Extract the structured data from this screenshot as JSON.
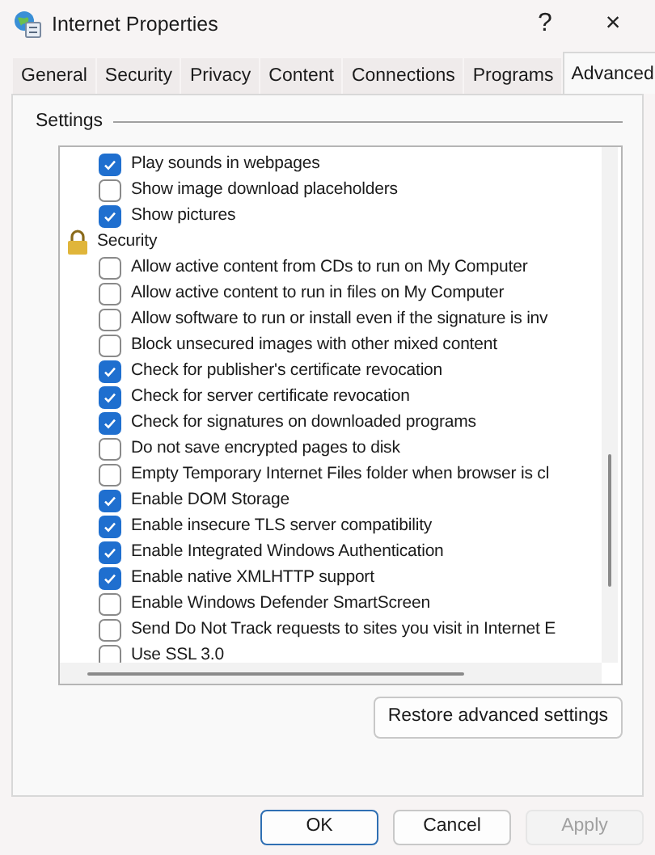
{
  "window": {
    "title": "Internet Properties",
    "help": "?",
    "close": "×"
  },
  "tabs": [
    {
      "label": "General",
      "selected": false
    },
    {
      "label": "Security",
      "selected": false
    },
    {
      "label": "Privacy",
      "selected": false
    },
    {
      "label": "Content",
      "selected": false
    },
    {
      "label": "Connections",
      "selected": false
    },
    {
      "label": "Programs",
      "selected": false
    },
    {
      "label": "Advanced",
      "selected": true
    }
  ],
  "settings_label": "Settings",
  "settings": [
    {
      "kind": "checkbox",
      "label": "Play sounds in webpages",
      "checked": true
    },
    {
      "kind": "checkbox",
      "label": "Show image download placeholders",
      "checked": false
    },
    {
      "kind": "checkbox",
      "label": "Show pictures",
      "checked": true
    },
    {
      "kind": "group",
      "label": "Security"
    },
    {
      "kind": "checkbox",
      "label": "Allow active content from CDs to run on My Computer",
      "checked": false
    },
    {
      "kind": "checkbox",
      "label": "Allow active content to run in files on My Computer",
      "checked": false
    },
    {
      "kind": "checkbox",
      "label": "Allow software to run or install even if the signature is inv",
      "checked": false
    },
    {
      "kind": "checkbox",
      "label": "Block unsecured images with other mixed content",
      "checked": false
    },
    {
      "kind": "checkbox",
      "label": "Check for publisher's certificate revocation",
      "checked": true
    },
    {
      "kind": "checkbox",
      "label": "Check for server certificate revocation",
      "checked": true
    },
    {
      "kind": "checkbox",
      "label": "Check for signatures on downloaded programs",
      "checked": true
    },
    {
      "kind": "checkbox",
      "label": "Do not save encrypted pages to disk",
      "checked": false
    },
    {
      "kind": "checkbox",
      "label": "Empty Temporary Internet Files folder when browser is cl",
      "checked": false
    },
    {
      "kind": "checkbox",
      "label": "Enable DOM Storage",
      "checked": true
    },
    {
      "kind": "checkbox",
      "label": "Enable insecure TLS server compatibility",
      "checked": true
    },
    {
      "kind": "checkbox",
      "label": "Enable Integrated Windows Authentication",
      "checked": true
    },
    {
      "kind": "checkbox",
      "label": "Enable native XMLHTTP support",
      "checked": true
    },
    {
      "kind": "checkbox",
      "label": "Enable Windows Defender SmartScreen",
      "checked": false
    },
    {
      "kind": "checkbox",
      "label": "Send Do Not Track requests to sites you visit in Internet E",
      "checked": false
    },
    {
      "kind": "checkbox",
      "label": "Use SSL 3.0",
      "checked": false
    }
  ],
  "restore_button": "Restore advanced settings",
  "buttons": [
    {
      "label": "OK",
      "disabled": false,
      "default": true
    },
    {
      "label": "Cancel",
      "disabled": false,
      "default": false
    },
    {
      "label": "Apply",
      "disabled": true,
      "default": false
    }
  ]
}
